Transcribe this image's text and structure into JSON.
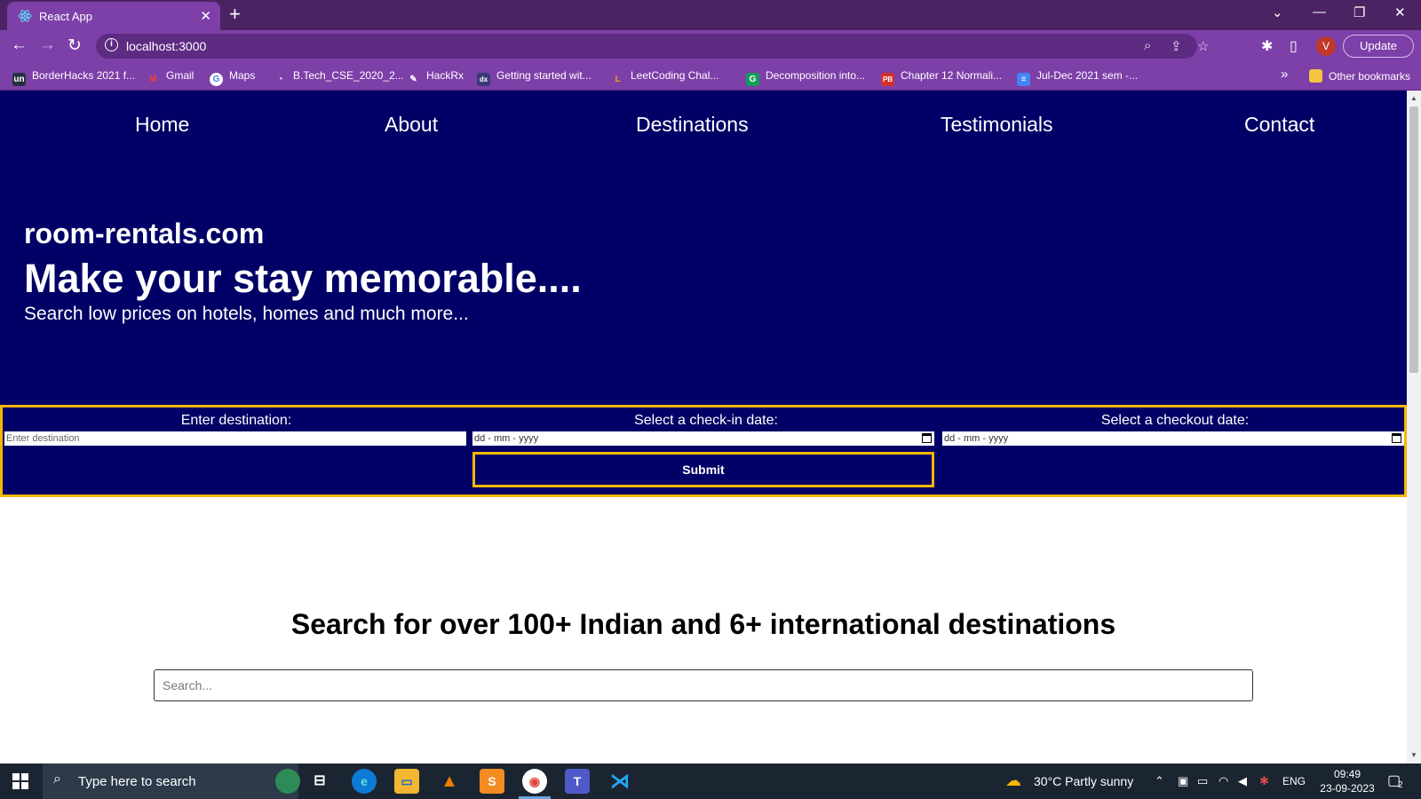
{
  "browser": {
    "tab_title": "React App",
    "url": "localhost:3000",
    "update_label": "Update",
    "profile_initial": "V",
    "bookmarks": [
      {
        "label": "BorderHacks 2021 f...",
        "icon_text": "un",
        "color": "#22313f"
      },
      {
        "label": "Gmail",
        "icon_text": "M",
        "color": "#ffffff"
      },
      {
        "label": "Maps",
        "icon_text": "G",
        "color": "#ffffff"
      },
      {
        "label": "B.Tech_CSE_2020_2...",
        "icon_text": "◔",
        "color": "#ffffff"
      },
      {
        "label": "HackRx",
        "icon_text": "✎",
        "color": "#7d3fa8"
      },
      {
        "label": "Getting started wit...",
        "icon_text": "dx",
        "color": "#3a3a7a"
      },
      {
        "label": "LeetCoding Chal...",
        "icon_text": "L",
        "color": "#f89f1b"
      },
      {
        "label": "Decomposition into...",
        "icon_text": "G",
        "color": "#0f9d58"
      },
      {
        "label": "Chapter 12 Normali...",
        "icon_text": "PB",
        "color": "#d32f2f"
      },
      {
        "label": "Jul-Dec 2021 sem -...",
        "icon_text": "≡",
        "color": "#4285f4"
      }
    ],
    "overflow_label": "»",
    "other_bookmarks": "Other bookmarks"
  },
  "nav": {
    "home": "Home",
    "about": "About",
    "destinations": "Destinations",
    "testimonials": "Testimonials",
    "contact": "Contact"
  },
  "hero": {
    "brand": "room-rentals.com",
    "headline": "Make your stay memorable....",
    "tagline": "Search low prices on hotels, homes and much more..."
  },
  "booking": {
    "destination_label": "Enter destination:",
    "destination_placeholder": "Enter destination",
    "checkin_label": "Select a check-in date:",
    "checkin_placeholder": "dd - mm - yyyy",
    "checkout_label": "Select a checkout date:",
    "checkout_placeholder": "dd - mm - yyyy",
    "submit_label": "Submit"
  },
  "destinations": {
    "heading": "Search for over 100+ Indian and 6+ international destinations",
    "search_placeholder": "Search..."
  },
  "taskbar": {
    "search_placeholder": "Type here to search",
    "weather": "30°C  Partly sunny",
    "language": "ENG",
    "time": "09:49",
    "date": "23-09-2023",
    "notification_count": "2"
  },
  "colors": {
    "hero_bg": "#000066",
    "accent_border": "#f5b700",
    "chrome_purple": "#7d3fa8"
  }
}
